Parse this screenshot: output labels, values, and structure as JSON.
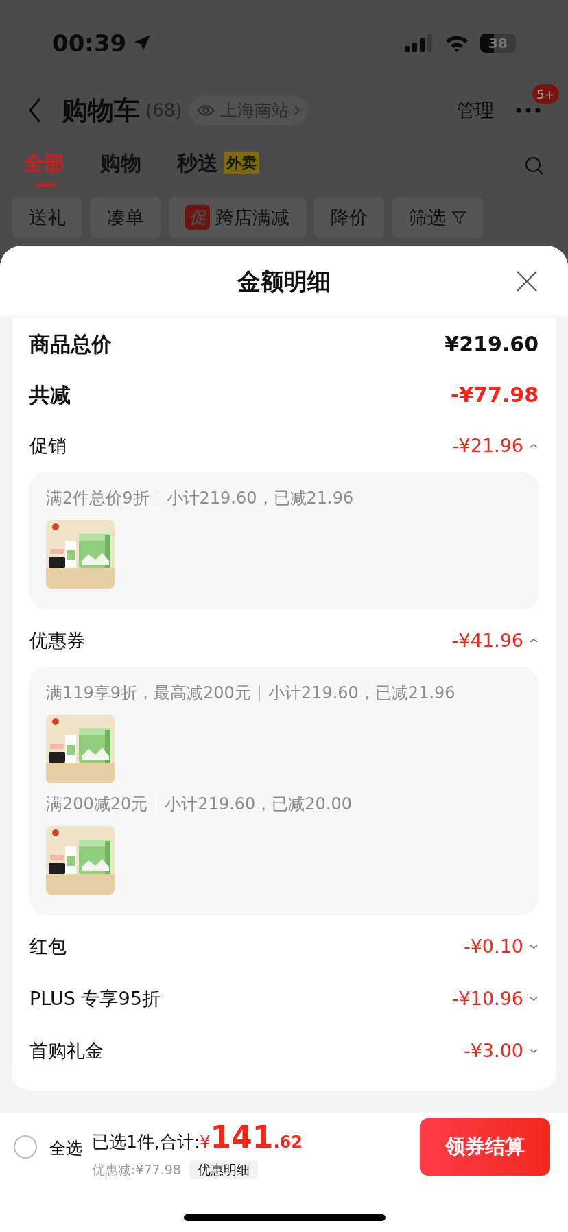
{
  "status_bar": {
    "time": "00:39",
    "battery": "38"
  },
  "header": {
    "title": "购物车",
    "count": "(68)",
    "location": "上海南站",
    "manage": "管理",
    "badge": "5+"
  },
  "tabs": [
    {
      "label": "全部",
      "selected": true
    },
    {
      "label": "购物",
      "selected": false
    },
    {
      "label": "秒送",
      "tag": "外卖",
      "selected": false
    }
  ],
  "filters": [
    {
      "kind": "plain",
      "label": "送礼"
    },
    {
      "kind": "plain",
      "label": "凑单"
    },
    {
      "kind": "promo",
      "tag": "促",
      "label": "跨店满减"
    },
    {
      "kind": "plain",
      "label": "降价"
    },
    {
      "kind": "filter",
      "label": "筛选"
    }
  ],
  "sheet": {
    "title": "金额明细",
    "summary": [
      {
        "label": "商品总价",
        "value": "¥219.60",
        "kind": "total"
      },
      {
        "label": "共减",
        "value": "-¥77.98",
        "kind": "reduction"
      }
    ],
    "sections": [
      {
        "label": "促销",
        "value": "-¥21.96",
        "expanded": true,
        "groups": [
          {
            "rule": "满2件总价9折",
            "detail": "小计219.60，已减21.96"
          }
        ]
      },
      {
        "label": "优惠券",
        "value": "-¥41.96",
        "expanded": true,
        "groups": [
          {
            "rule": "满119享9折，最高减200元",
            "detail": "小计219.60，已减21.96"
          },
          {
            "rule": "满200减20元",
            "detail": "小计219.60，已减20.00"
          }
        ]
      },
      {
        "label": "红包",
        "value": "-¥0.10",
        "expanded": false
      },
      {
        "label": "PLUS 专享95折",
        "value": "-¥10.96",
        "expanded": false
      },
      {
        "label": "首购礼金",
        "value": "-¥3.00",
        "expanded": false
      }
    ]
  },
  "bottom_bar": {
    "select_all": {
      "label": "全选",
      "checked": false
    },
    "selected_text": "已选1件,合计:",
    "currency": "¥",
    "price_int": "141",
    "price_dec": ".62",
    "discount": "优惠减:¥77.98",
    "detail_button": "优惠明细",
    "checkout": "领券结算"
  }
}
